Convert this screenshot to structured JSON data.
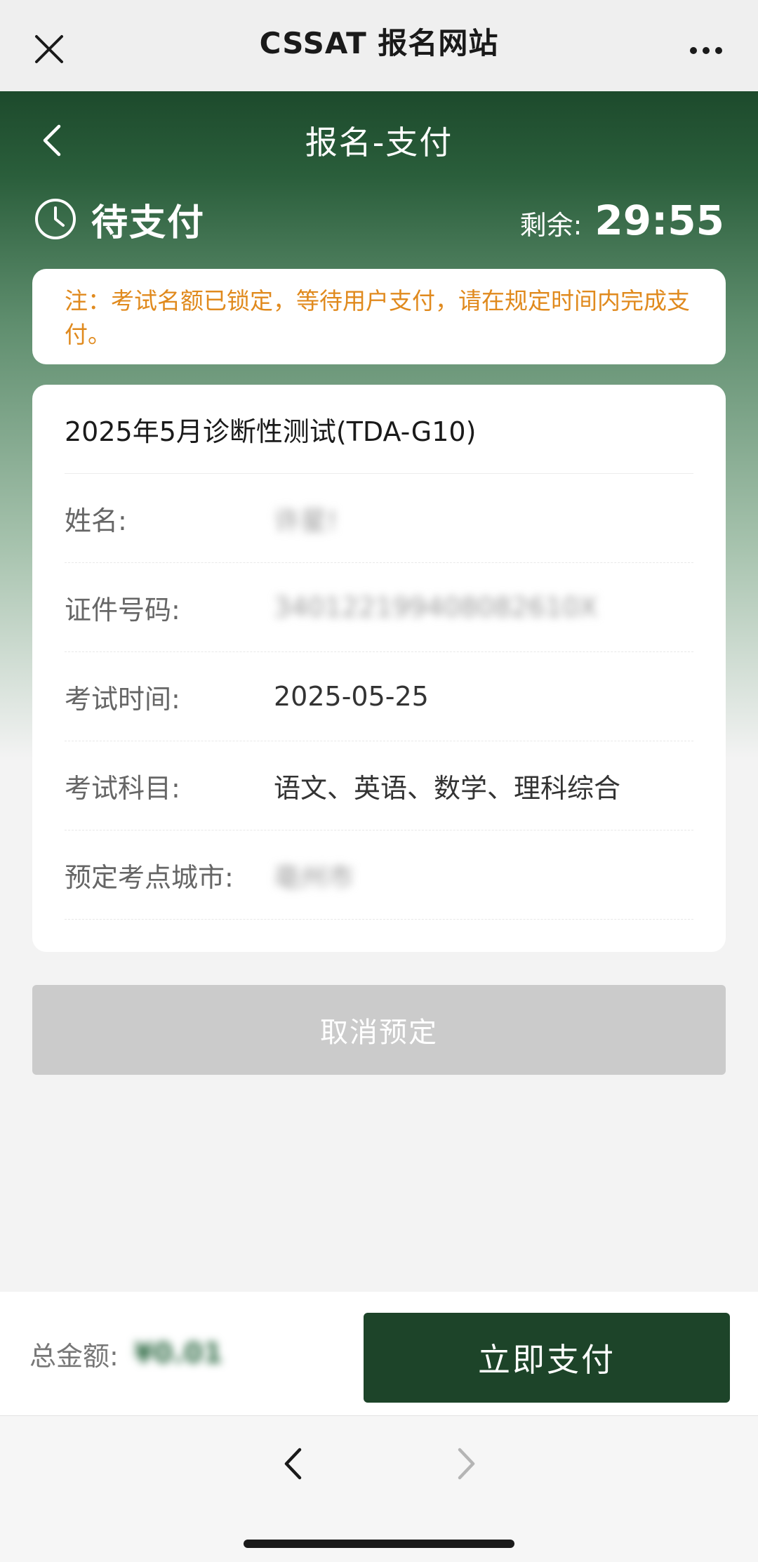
{
  "topbar": {
    "title": "CSSAT 报名网站",
    "close_icon": "close-icon",
    "more_icon": "more-dots-icon"
  },
  "page": {
    "title": "报名-支付",
    "back_icon": "chevron-left-icon"
  },
  "status": {
    "icon": "clock-icon",
    "text": "待支付",
    "timer_label": "剩余:",
    "timer_value": "29:55"
  },
  "notice": {
    "text": "注：考试名额已锁定，等待用户支付，请在规定时间内完成支付。"
  },
  "exam": {
    "title": "2025年5月诊断性测试(TDA-G10)",
    "rows": [
      {
        "label": "姓名:",
        "value": "许星!",
        "blurred": true
      },
      {
        "label": "证件号码:",
        "value": "340122199408082610X",
        "blurred": true
      },
      {
        "label": "考试时间:",
        "value": "2025-05-25",
        "blurred": false
      },
      {
        "label": "考试科目:",
        "value": "语文、英语、数学、理科综合",
        "blurred": false
      },
      {
        "label": "预定考点城市:",
        "value": "亳州市",
        "blurred": true
      }
    ]
  },
  "actions": {
    "cancel_label": "取消预定",
    "pay_label": "立即支付"
  },
  "payment": {
    "total_label": "总金额:",
    "total_value": "¥0.01"
  },
  "browser": {
    "back_icon": "chevron-left-icon",
    "forward_icon": "chevron-right-icon"
  },
  "colors": {
    "brand_green": "#1d4429",
    "notice_orange": "#e08a1e",
    "disabled_gray": "#cbcbcb"
  }
}
